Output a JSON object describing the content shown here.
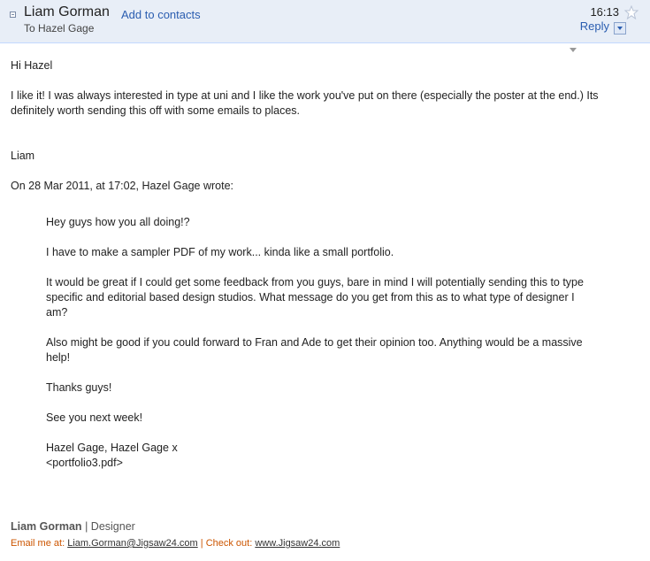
{
  "header": {
    "sender": "Liam Gorman",
    "add_contacts": "Add to contacts",
    "to_line": "To Hazel Gage",
    "time": "16:13",
    "reply": "Reply"
  },
  "message": {
    "greeting": "Hi Hazel",
    "paragraph": "I like it! I was always interested in type at uni and I like the work you've put on there (especially the poster at the end.) Its definitely worth sending this off with some emails to places.",
    "signoff": "Liam",
    "quote_header": "On 28 Mar 2011, at 17:02, Hazel Gage wrote:"
  },
  "quoted": {
    "line1": "Hey guys how you all doing!?",
    "line2": "I have to make a sampler PDF of my work... kinda like a small portfolio.",
    "line3": "It would be great if I could get some feedback from you guys, bare in mind I will potentially sending this to type specific and editorial based design studios. What message do you get from this as to what type of designer I am?",
    "line4": "Also might be good if you could forward to Fran and Ade to get their opinion too. Anything would be a massive help!",
    "line5": "Thanks guys!",
    "line6": "See you next week!",
    "line7": "Hazel Gage, Hazel Gage x",
    "attachment": "<portfolio3.pdf>"
  },
  "signature": {
    "name": "Liam Gorman",
    "separator": "|",
    "title": "Designer",
    "email_label": "Email me at:",
    "email": "Liam.Gorman@Jigsaw24.com",
    "checkout_label": "Check out:",
    "website": "www.Jigsaw24.com"
  },
  "colors": {
    "header_bg": "#e8eef7",
    "link": "#2a5db0",
    "signature_accent": "#cc5500"
  }
}
